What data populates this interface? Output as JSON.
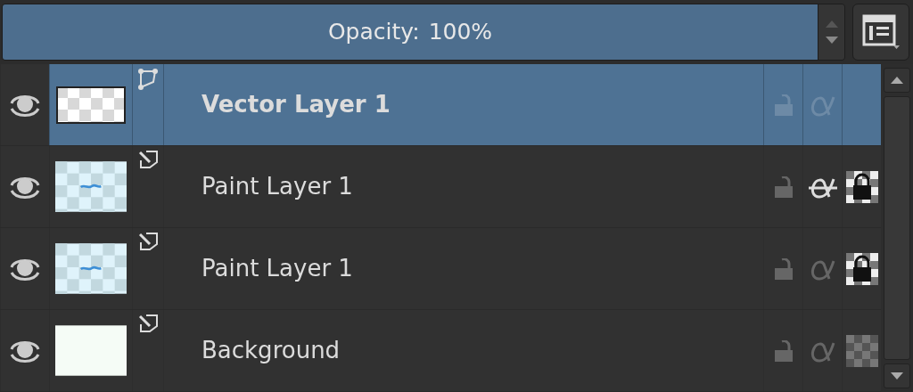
{
  "opacity": {
    "label": "Opacity:",
    "value": "100%",
    "level": 1.0
  },
  "layers": [
    {
      "name": "Vector Layer 1",
      "kind": "vector",
      "thumbnail": {
        "kind": "checker"
      },
      "selected": true,
      "visible": true,
      "locked": false,
      "inherit_alpha": true
    },
    {
      "name": "Paint Layer 1",
      "kind": "paint",
      "thumbnail": {
        "kind": "blue"
      },
      "selected": false,
      "visible": true,
      "locked": false,
      "inherit_alpha": false,
      "alpha_locked": true
    },
    {
      "name": "Paint Layer 1",
      "kind": "paint",
      "thumbnail": {
        "kind": "blue"
      },
      "selected": false,
      "visible": true,
      "locked": false,
      "inherit_alpha": true,
      "alpha_locked": true
    },
    {
      "name": "Background",
      "kind": "paint",
      "thumbnail": {
        "kind": "plain"
      },
      "selected": false,
      "visible": true,
      "locked": false,
      "inherit_alpha": true,
      "alpha_locked": false
    }
  ]
}
